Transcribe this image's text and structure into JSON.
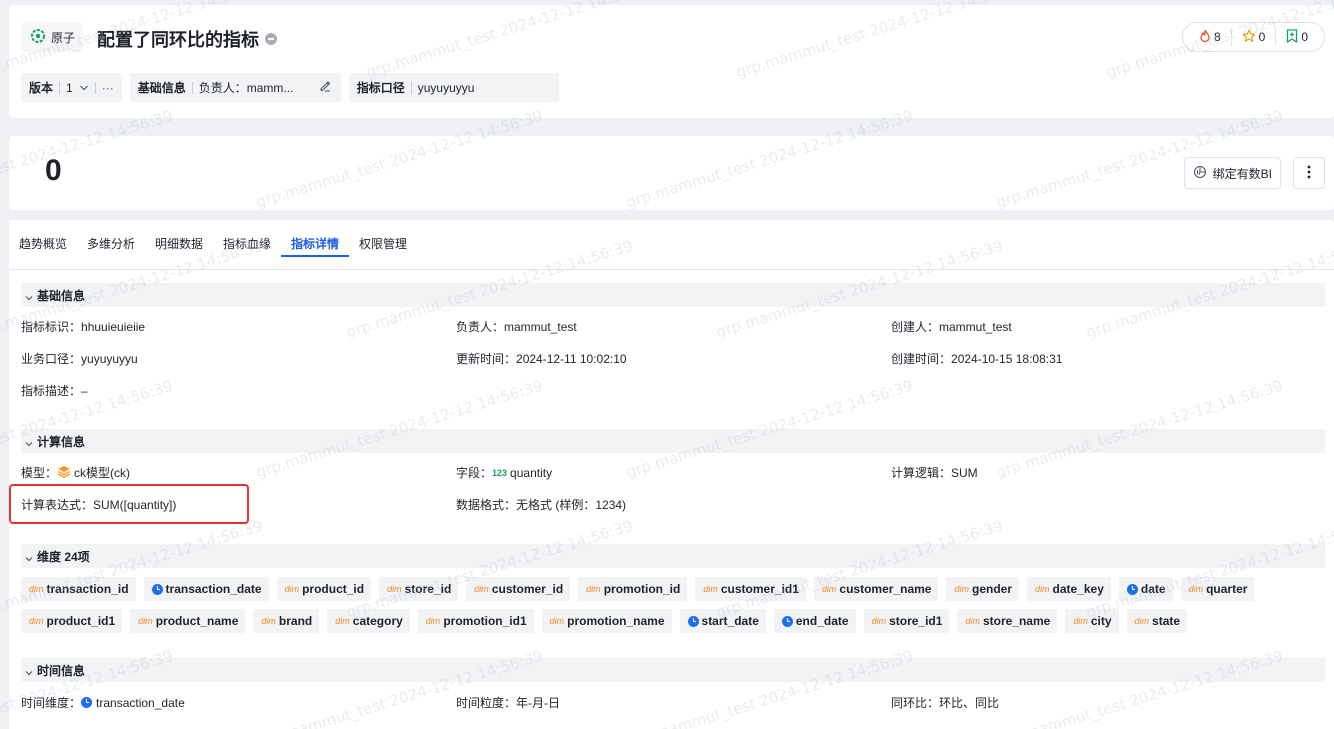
{
  "header": {
    "type_label": "原子",
    "title": "配置了同环比的指标",
    "counters": [
      {
        "icon": "fire-icon",
        "value": "8"
      },
      {
        "icon": "star-icon",
        "value": "0"
      },
      {
        "icon": "bookmark-plus-icon",
        "value": "0"
      }
    ],
    "version_label": "版本",
    "version_value": "1",
    "more_glyph": "···",
    "basic_info_label": "基础信息",
    "owner_label": "负责人：",
    "owner_value": "mamm...",
    "caliber_label": "指标口径",
    "caliber_value": "yuyuyuyyu"
  },
  "value_card": {
    "value": "0",
    "bind_button_label": "绑定有数BI"
  },
  "tabs": [
    {
      "label": "趋势概览"
    },
    {
      "label": "多维分析"
    },
    {
      "label": "明细数据"
    },
    {
      "label": "指标血缘"
    },
    {
      "label": "指标详情",
      "active": true
    },
    {
      "label": "权限管理"
    }
  ],
  "basic_section": {
    "title": "基础信息",
    "id_label": "指标标识：",
    "id_value": "hhuuieuieiie",
    "owner_label": "负责人：",
    "owner_value": "mammut_test",
    "creator_label": "创建人：",
    "creator_value": "mammut_test",
    "caliber_label": "业务口径：",
    "caliber_value": "yuyuyuyyu",
    "updated_label": "更新时间：",
    "updated_value": "2024-12-11 10:02:10",
    "created_label": "创建时间：",
    "created_value": "2024-10-15 18:08:31",
    "desc_label": "指标描述：",
    "desc_value": "–"
  },
  "calc_section": {
    "title": "计算信息",
    "model_label": "模型：",
    "model_value": "ck模型(ck)",
    "field_label": "字段：",
    "field_tag": "123",
    "field_value": "quantity",
    "logic_label": "计算逻辑：",
    "logic_value": "SUM",
    "expr_label": "计算表达式：",
    "expr_value": "SUM([quantity])",
    "format_label": "数据格式：",
    "format_value": "无格式 (样例：1234)"
  },
  "dimension_section": {
    "title": "维度 24项",
    "dim_tag": "dim",
    "rows": [
      [
        {
          "label": "transaction_id",
          "kind": "dim"
        },
        {
          "label": "transaction_date",
          "kind": "time"
        },
        {
          "label": "product_id",
          "kind": "dim"
        },
        {
          "label": "store_id",
          "kind": "dim"
        },
        {
          "label": "customer_id",
          "kind": "dim"
        },
        {
          "label": "promotion_id",
          "kind": "dim"
        },
        {
          "label": "customer_id1",
          "kind": "dim"
        },
        {
          "label": "customer_name",
          "kind": "dim"
        },
        {
          "label": "gender",
          "kind": "dim"
        },
        {
          "label": "date_key",
          "kind": "dim"
        },
        {
          "label": "date",
          "kind": "time"
        },
        {
          "label": "quarter",
          "kind": "dim"
        }
      ],
      [
        {
          "label": "product_id1",
          "kind": "dim"
        },
        {
          "label": "product_name",
          "kind": "dim"
        },
        {
          "label": "brand",
          "kind": "dim"
        },
        {
          "label": "category",
          "kind": "dim"
        },
        {
          "label": "promotion_id1",
          "kind": "dim"
        },
        {
          "label": "promotion_name",
          "kind": "dim"
        },
        {
          "label": "start_date",
          "kind": "time"
        },
        {
          "label": "end_date",
          "kind": "time"
        },
        {
          "label": "store_id1",
          "kind": "dim"
        },
        {
          "label": "store_name",
          "kind": "dim"
        },
        {
          "label": "city",
          "kind": "dim"
        },
        {
          "label": "state",
          "kind": "dim"
        }
      ]
    ]
  },
  "time_section": {
    "title": "时间信息",
    "dim_label": "时间维度：",
    "dim_value": "transaction_date",
    "grain_label": "时间粒度：",
    "grain_value": "年-月-日",
    "compare_label": "同环比：",
    "compare_value": "环比、同比"
  },
  "watermark": "grp.mammut_test 2024-12-12 14:56:39",
  "colors": {
    "accent": "#1d5de8",
    "highlight_border": "#e5322d",
    "dim_tag": "#f08a24",
    "page_bg": "#eef0f3"
  }
}
